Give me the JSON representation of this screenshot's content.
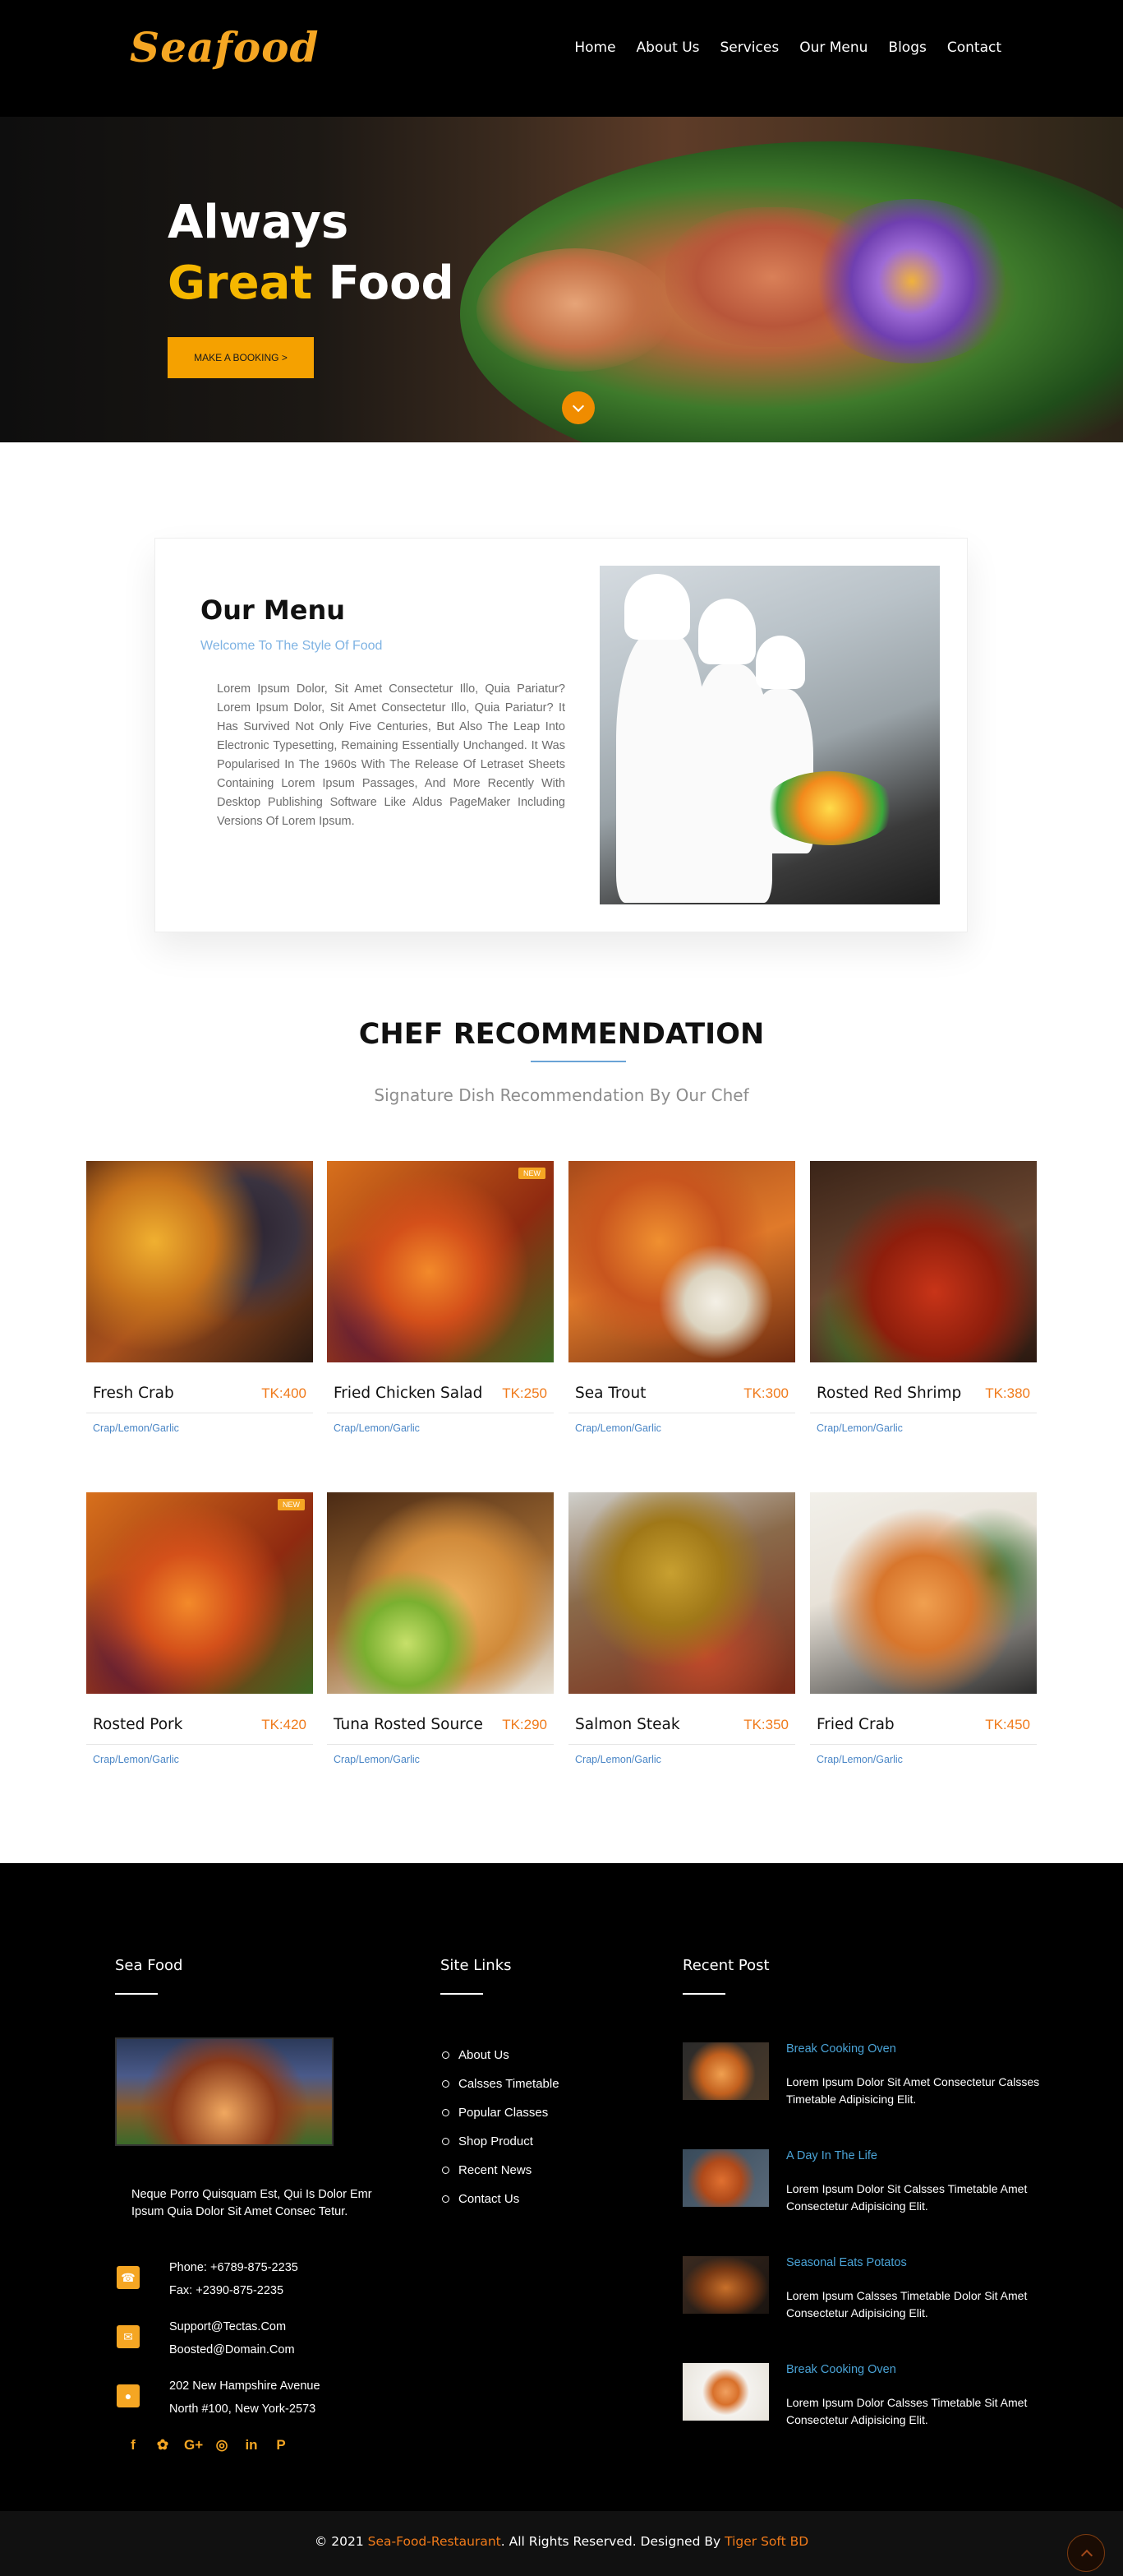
{
  "header": {
    "logo": "Seafood",
    "nav": [
      "Home",
      "About Us",
      "Services",
      "Our Menu",
      "Blogs",
      "Contact"
    ]
  },
  "hero": {
    "line1": "Always",
    "line2_accent": "Great",
    "line2_rest": "Food",
    "button": "MAKE A BOOKING >",
    "accent_color": "#f5b700"
  },
  "menu": {
    "title": "Our Menu",
    "subtitle": "Welcome To The Style Of Food",
    "text": "Lorem Ipsum Dolor, Sit Amet Consectetur Illo, Quia Pariatur? Lorem Ipsum Dolor, Sit Amet Consectetur Illo, Quia Pariatur? It Has Survived Not Only Five Centuries, But Also The Leap Into Electronic Typesetting, Remaining Essentially Unchanged. It Was Popularised In The 1960s With The Release Of Letraset Sheets Containing Lorem Ipsum Passages, And More Recently With Desktop Publishing Software Like Aldus PageMaker Including Versions Of Lorem Ipsum."
  },
  "recommendation": {
    "title": "CHEF RECOMMENDATION",
    "subtitle": "Signature Dish Recommendation By Our Chef",
    "badge": "NEW",
    "dishes": [
      {
        "name": "Fresh Crab",
        "price": "TK:400",
        "tags": "Crap/Lemon/Garlic"
      },
      {
        "name": "Fried Chicken Salad",
        "price": "TK:250",
        "tags": "Crap/Lemon/Garlic"
      },
      {
        "name": "Sea Trout",
        "price": "TK:300",
        "tags": "Crap/Lemon/Garlic"
      },
      {
        "name": "Rosted Red Shrimp",
        "price": "TK:380",
        "tags": "Crap/Lemon/Garlic"
      },
      {
        "name": "Rosted Pork",
        "price": "TK:420",
        "tags": "Crap/Lemon/Garlic"
      },
      {
        "name": "Tuna Rosted Source",
        "price": "TK:290",
        "tags": "Crap/Lemon/Garlic"
      },
      {
        "name": "Salmon Steak",
        "price": "TK:350",
        "tags": "Crap/Lemon/Garlic"
      },
      {
        "name": "Fried Crab",
        "price": "TK:450",
        "tags": "Crap/Lemon/Garlic"
      }
    ]
  },
  "footer": {
    "seafood_heading": "Sea Food",
    "about": "Neque Porro Quisquam Est, Qui Is Dolor Emr Ipsum Quia Dolor Sit Amet Consec Tetur.",
    "phone": "Phone: +6789-875-2235",
    "fax": "Fax: +2390-875-2235",
    "email1": "Support@Tectas.Com",
    "email2": "Boosted@Domain.Com",
    "address1": "202 New Hampshire Avenue",
    "address2": "North #100, New York-2573",
    "social_icons": [
      "facebook-icon",
      "twitter-icon",
      "google-plus-icon",
      "dribbble-icon",
      "linkedin-icon",
      "pinterest-icon"
    ],
    "links_heading": "Site Links",
    "links": [
      "About Us",
      "Calsses Timetable",
      "Popular Classes",
      "Shop Product",
      "Recent News",
      "Contact Us"
    ],
    "recent_heading": "Recent Post",
    "posts": [
      {
        "title": "Break Cooking Oven",
        "text": "Lorem Ipsum Dolor Sit Amet Consectetur Calsses Timetable Adipisicing Elit."
      },
      {
        "title": "A Day In The Life",
        "text": "Lorem Ipsum Dolor Sit Calsses Timetable Amet Consectetur Adipisicing Elit."
      },
      {
        "title": "Seasonal Eats Potatos",
        "text": "Lorem Ipsum Calsses Timetable Dolor Sit Amet Consectetur Adipisicing Elit."
      },
      {
        "title": "Break Cooking Oven",
        "text": "Lorem Ipsum Dolor Calsses Timetable Sit Amet Consectetur Adipisicing Elit."
      }
    ]
  },
  "copyright": {
    "prefix": "© 2021 ",
    "site": "Sea-Food-Restaurant",
    "middle": ". All Rights Reserved. Designed By ",
    "designer": "Tiger Soft BD"
  }
}
